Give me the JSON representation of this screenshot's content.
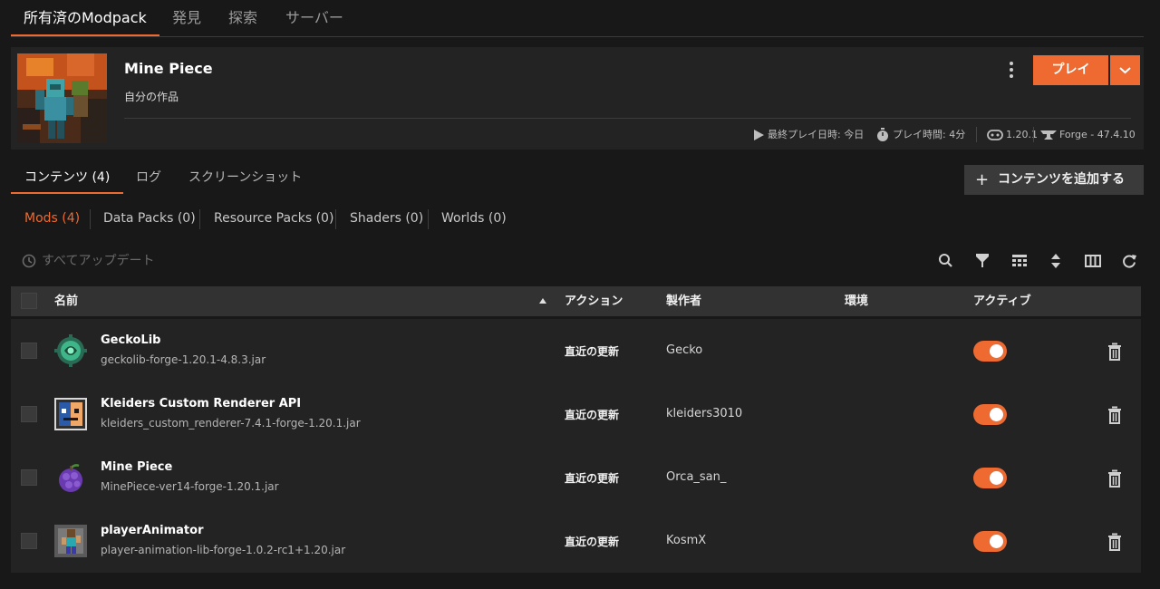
{
  "top_tabs": [
    {
      "label": "所有済のModpack",
      "active": true
    },
    {
      "label": "発見"
    },
    {
      "label": "探索"
    },
    {
      "label": "サーバー"
    }
  ],
  "pack": {
    "title": "Mine Piece",
    "subtitle": "自分の作品",
    "play_label": "プレイ",
    "last_played": "最終プレイ日時: 今日",
    "play_time": "プレイ時間: 4分",
    "game_version": "1.20.1",
    "loader": "Forge - 47.4.10"
  },
  "content_tabs": [
    {
      "label": "コンテンツ (4)",
      "active": true
    },
    {
      "label": "ログ"
    },
    {
      "label": "スクリーンショット"
    }
  ],
  "add_content_label": "コンテンツを追加する",
  "filters": [
    {
      "label": "Mods (4)",
      "active": true
    },
    {
      "label": "Data Packs (0)"
    },
    {
      "label": "Resource Packs (0)"
    },
    {
      "label": "Shaders (0)"
    },
    {
      "label": "Worlds (0)"
    }
  ],
  "update_all_label": "すべてアップデート",
  "toolbar_icons": [
    "search-icon",
    "filter-icon",
    "density-icon",
    "sort-icon",
    "columns-icon",
    "refresh-icon"
  ],
  "table": {
    "headers": {
      "name": "名前",
      "action": "アクション",
      "author": "製作者",
      "env": "環境",
      "active": "アクティブ"
    },
    "rows": [
      {
        "name": "GeckoLib",
        "file": "geckolib-forge-1.20.1-4.8.3.jar",
        "action": "直近の更新",
        "author": "Gecko",
        "active": true,
        "icon": "geckolib-icon"
      },
      {
        "name": "Kleiders Custom Renderer API",
        "file": "kleiders_custom_renderer-7.4.1-forge-1.20.1.jar",
        "action": "直近の更新",
        "author": "kleiders3010",
        "active": true,
        "icon": "kleiders-icon"
      },
      {
        "name": "Mine Piece",
        "file": "MinePiece-ver14-forge-1.20.1.jar",
        "action": "直近の更新",
        "author": "Orca_san_",
        "active": true,
        "icon": "devil-fruit-icon"
      },
      {
        "name": "playerAnimator",
        "file": "player-animation-lib-forge-1.0.2-rc1+1.20.jar",
        "action": "直近の更新",
        "author": "KosmX",
        "active": true,
        "icon": "player-animator-icon"
      }
    ]
  },
  "colors": {
    "accent": "#ee6a30",
    "background": "#181818",
    "panel": "#232323"
  }
}
